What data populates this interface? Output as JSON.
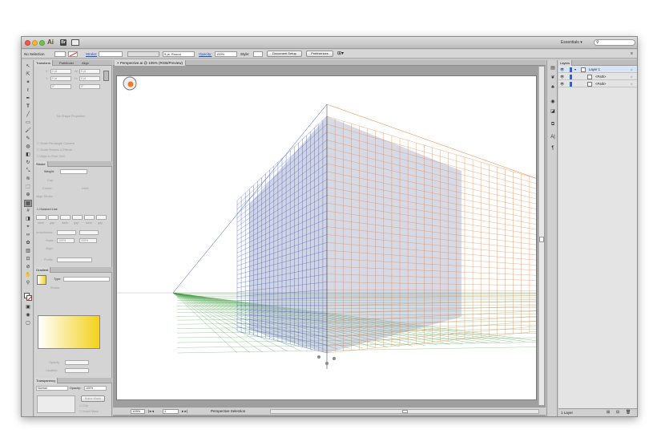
{
  "app": {
    "logo": "Ai",
    "workspace": "Essentials",
    "search_placeholder": ""
  },
  "icons": {
    "bridge": "bridge-icon",
    "arrange": "arrange-documents-icon",
    "search": "search-icon"
  },
  "control_bar": {
    "selection_label": "No Selection",
    "stroke_link": "Stroke:",
    "brush_value": "5 pt. Round",
    "opacity_link": "Opacity:",
    "opacity_value": "100%",
    "style_label": "Style:",
    "doc_setup": "Document Setup",
    "preferences": "Preferences"
  },
  "transform_panel": {
    "tabs": [
      "Transform",
      "Pathfinder",
      "Align"
    ],
    "x_label": "X:",
    "y_label": "Y:",
    "w_label": "W:",
    "h_label": "H:",
    "x_value": "0 pt",
    "y_value": "0 pt",
    "w_value": "0 pt",
    "h_value": "0 pt",
    "angle_value": "0°",
    "shear_value": "0°",
    "no_shape": "No Shape Properties",
    "checkboxes": [
      "Scale Rectangle Corners",
      "Scale Strokes & Effects",
      "Align to Pixel Grid"
    ]
  },
  "stroke_panel": {
    "title": "Stroke",
    "weight_label": "Weight:",
    "cap_label": "Cap:",
    "corner_label": "Corner:",
    "limit_label": "Limit:",
    "align_label": "Align Stroke:",
    "dashed_label": "Dashed Line",
    "dash_cols": [
      "dash",
      "gap",
      "dash",
      "gap",
      "dash",
      "gap"
    ],
    "arrowheads_label": "Arrowheads:",
    "scale_label": "Scale:",
    "scale_left": "100%",
    "scale_right": "100%",
    "align2_label": "Align:",
    "profile_label": "Profile:"
  },
  "gradient_panel": {
    "title": "Gradient",
    "type_label": "Type:",
    "stroke_label": "Stroke:",
    "opacity_label": "Opacity:",
    "location_label": "Location:",
    "colors": {
      "start": "#ffffff",
      "end": "#f2d21c"
    }
  },
  "transparency_panel": {
    "title": "Transparency",
    "mode": "Normal",
    "opacity_label": "Opacity:",
    "opacity_value": "100%",
    "make_mask": "Make Mask",
    "clip": "Clip",
    "invert_mask": "Invert Mask"
  },
  "document": {
    "tab_label": "Perspective.ai @ 105% (RGB/Preview)",
    "colors": {
      "left_plane": "#3553c8",
      "right_plane": "#f07828",
      "ground_plane": "#3b9a3b"
    }
  },
  "status": {
    "zoom": "105%",
    "page": "1",
    "tool_label": "Perspective Selection"
  },
  "layers_panel": {
    "title": "Layers",
    "layers": [
      "Layer 1",
      "<Path>",
      "<Path>"
    ],
    "footer_label": "1 Layer"
  }
}
